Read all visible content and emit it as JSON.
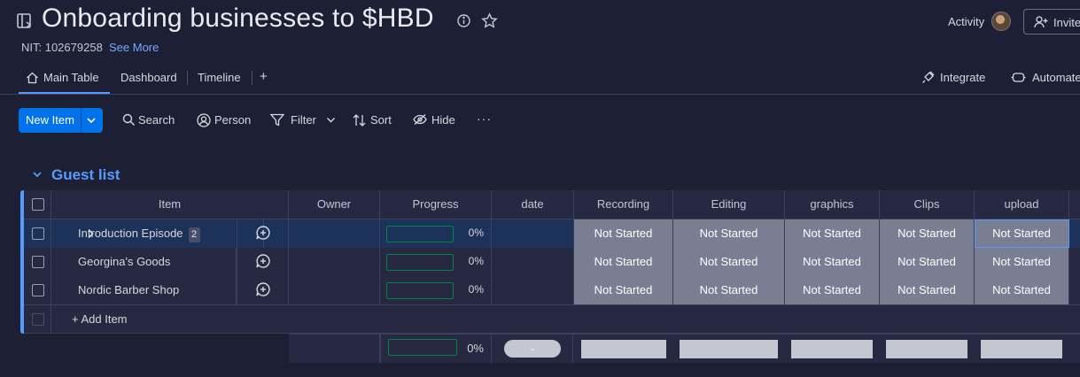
{
  "header": {
    "title": "Onboarding businesses to $HBD",
    "subtitle": "NIT: 102679258",
    "see_more": "See More",
    "activity": "Activity",
    "invite": "Invite"
  },
  "tabs": [
    {
      "label": "Main Table",
      "active": true
    },
    {
      "label": "Dashboard"
    },
    {
      "label": "Timeline"
    },
    {
      "label": "+"
    }
  ],
  "right_actions": {
    "integrate": "Integrate",
    "automate": "Automate"
  },
  "toolbar": {
    "new_item": "New Item",
    "search": "Search",
    "person": "Person",
    "filter": "Filter",
    "sort": "Sort",
    "hide": "Hide",
    "more": "···"
  },
  "group": {
    "title": "Guest list",
    "color": "#579bfc",
    "columns": [
      "Item",
      "Owner",
      "Progress",
      "date",
      "Recording",
      "Editing",
      "graphics",
      "Clips",
      "upload"
    ],
    "rows": [
      {
        "name": "Introduction Episode",
        "subitems": "2",
        "owner": "",
        "progress": "0%",
        "date": "",
        "statuses": [
          "Not Started",
          "Not Started",
          "Not Started",
          "Not Started",
          "Not Started"
        ]
      },
      {
        "name": "Georgina's Goods",
        "owner": "",
        "progress": "0%",
        "date": "",
        "statuses": [
          "Not Started",
          "Not Started",
          "Not Started",
          "Not Started",
          "Not Started"
        ]
      },
      {
        "name": "Nordic Barber Shop",
        "owner": "",
        "progress": "0%",
        "date": "",
        "statuses": [
          "Not Started",
          "Not Started",
          "Not Started",
          "Not Started",
          "Not Started"
        ]
      }
    ],
    "add_item": "+ Add Item",
    "summary": {
      "progress": "0%",
      "date": "-"
    }
  },
  "colors": {
    "accent": "#0073ea",
    "status_not_started": "#797e93",
    "background": "#1d2034"
  }
}
